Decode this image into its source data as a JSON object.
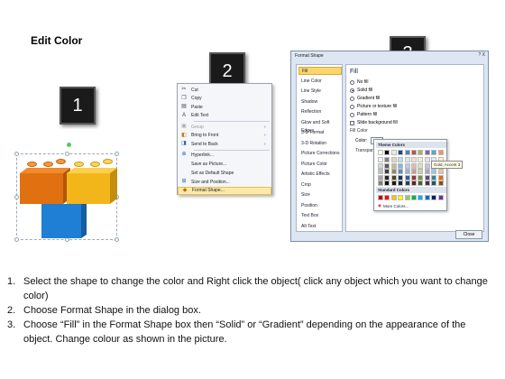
{
  "page": {
    "title": "Edit Color"
  },
  "badges": [
    "1",
    "2",
    "3"
  ],
  "colors": {
    "orange": "#e07010",
    "yellow": "#f3b61a",
    "blue": "#1f7fd4",
    "highlight": "#fde9a6"
  },
  "context_menu": {
    "items": [
      {
        "icon": "cut-icon",
        "label": "Cut",
        "enabled": true,
        "submenu": false
      },
      {
        "icon": "copy-icon",
        "label": "Copy",
        "enabled": true,
        "submenu": false
      },
      {
        "icon": "paste-icon",
        "label": "Paste",
        "enabled": true,
        "submenu": false
      },
      {
        "icon": "edit-text-icon",
        "label": "Edit Text",
        "enabled": true,
        "submenu": false
      },
      {
        "icon": "group-icon",
        "label": "Group",
        "enabled": false,
        "submenu": true
      },
      {
        "icon": "bring-to-front-icon",
        "label": "Bring to Front",
        "enabled": true,
        "submenu": true
      },
      {
        "icon": "send-to-back-icon",
        "label": "Send to Back",
        "enabled": true,
        "submenu": true
      },
      {
        "icon": "hyperlink-icon",
        "label": "Hyperlink...",
        "enabled": true,
        "submenu": false
      },
      {
        "icon": "save-picture-icon",
        "label": "Save as Picture...",
        "enabled": true,
        "submenu": false
      },
      {
        "icon": "default-shape-icon",
        "label": "Set as Default Shape",
        "enabled": true,
        "submenu": false
      },
      {
        "icon": "size-position-icon",
        "label": "Size and Position...",
        "enabled": true,
        "submenu": false
      },
      {
        "icon": "format-shape-icon",
        "label": "Format Shape...",
        "enabled": true,
        "submenu": false,
        "highlighted": true
      }
    ]
  },
  "dialog": {
    "title": "Format Shape",
    "window_buttons": "? X",
    "nav": [
      "Fill",
      "Line Color",
      "Line Style",
      "Shadow",
      "Reflection",
      "Glow and Soft Edges",
      "3-D Format",
      "3-D Rotation",
      "Picture Corrections",
      "Picture Color",
      "Artistic Effects",
      "Crop",
      "Size",
      "Position",
      "Text Box",
      "Alt Text"
    ],
    "selected_nav": "Fill",
    "fill_heading": "Fill",
    "fill_options": [
      {
        "label": "No fill",
        "type": "radio",
        "checked": false
      },
      {
        "label": "Solid fill",
        "type": "radio",
        "checked": true
      },
      {
        "label": "Gradient fill",
        "type": "radio",
        "checked": false
      },
      {
        "label": "Picture or texture fill",
        "type": "radio",
        "checked": false
      },
      {
        "label": "Pattern fill",
        "type": "radio",
        "checked": false
      },
      {
        "label": "Slide background fill",
        "type": "checkbox",
        "checked": false
      }
    ],
    "fill_color_heading": "Fill Color",
    "color_label": "Color:",
    "transparency_label": "Transparency:",
    "close_label": "Close"
  },
  "palette": {
    "theme_heading": "Theme Colors",
    "standard_heading": "Standard Colors",
    "more_colors": "More Colors...",
    "tooltip": "Gold, Accent 3",
    "theme_top": [
      "#ffffff",
      "#000000",
      "#eeece1",
      "#1f497d",
      "#4f81bd",
      "#c0504d",
      "#9bbb59",
      "#8064a2",
      "#4bacc6",
      "#f79646"
    ],
    "theme_shades": [
      [
        "#f2f2f2",
        "#7f7f7f",
        "#ddd9c3",
        "#c6d9f0",
        "#dbe5f1",
        "#f2dcdb",
        "#ebf1dd",
        "#e5e0ec",
        "#dbeef3",
        "#fdeada"
      ],
      [
        "#d8d8d8",
        "#595959",
        "#c4bd97",
        "#8db3e2",
        "#b8cce4",
        "#e5b9b7",
        "#d7e3bc",
        "#ccc1d9",
        "#b7dde8",
        "#fbd5b5"
      ],
      [
        "#bfbfbf",
        "#3f3f3f",
        "#938953",
        "#548dd4",
        "#95b3d7",
        "#d99694",
        "#c3d69b",
        "#b2a2c7",
        "#92cddc",
        "#fac08f"
      ],
      [
        "#a5a5a5",
        "#262626",
        "#494429",
        "#17365d",
        "#366092",
        "#953734",
        "#76923c",
        "#5f497a",
        "#31859b",
        "#e36c09"
      ],
      [
        "#7f7f7f",
        "#0c0c0c",
        "#1d1b10",
        "#0f243e",
        "#244061",
        "#632423",
        "#4f6128",
        "#3f3151",
        "#205867",
        "#974806"
      ]
    ],
    "standard": [
      "#c00000",
      "#ff0000",
      "#ffc000",
      "#ffff00",
      "#92d050",
      "#00b050",
      "#00b0f0",
      "#0070c0",
      "#002060",
      "#7030a0"
    ]
  },
  "instructions": [
    {
      "num": "1.",
      "text": "Select the shape to change the color and Right click the object( click any object which you want to change color)"
    },
    {
      "num": "2.",
      "text": "Choose Format Shape in the dialog box."
    },
    {
      "num": "3.",
      "text": "Choose “Fill” in the Format Shape box then “Solid” or “Gradient” depending on the appearance of the object. Change colour as shown in the picture."
    }
  ]
}
